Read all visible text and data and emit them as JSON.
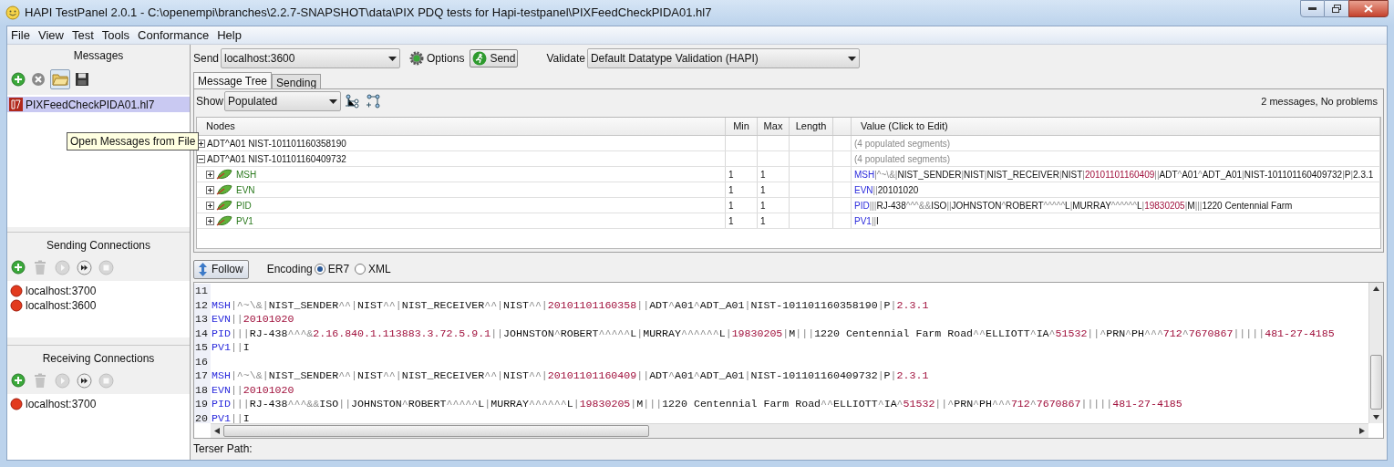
{
  "window": {
    "title": "HAPI TestPanel 2.0.1 - C:\\openempi\\branches\\2.2.7-SNAPSHOT\\data\\PIX PDQ tests for Hapi-testpanel\\PIXFeedCheckPIDA01.hl7"
  },
  "menu": [
    "File",
    "View",
    "Test",
    "Tools",
    "Conformance",
    "Help"
  ],
  "messages_panel": {
    "title": "Messages",
    "files": [
      {
        "name": "PIXFeedCheckPIDA01.hl7",
        "selected": true
      }
    ],
    "tooltip": "Open Messages from File"
  },
  "sending_connections": {
    "title": "Sending Connections",
    "items": [
      "localhost:3700",
      "localhost:3600"
    ]
  },
  "receiving_connections": {
    "title": "Receiving Connections",
    "items": [
      "localhost:3700"
    ]
  },
  "toolbar": {
    "send_label": "Send",
    "send_target": "localhost:3600",
    "options_button": "Options",
    "send_button": "Send",
    "validate_label": "Validate",
    "validator": "Default Datatype Validation (HAPI)"
  },
  "tabs": [
    {
      "label": "Message Tree",
      "selected": true
    },
    {
      "label": "Sending",
      "selected": false
    }
  ],
  "tree": {
    "show_label": "Show",
    "show_value": "Populated",
    "status": "2 messages, No problems",
    "columns": [
      "Nodes",
      "Min",
      "Max",
      "Length",
      "Value (Click to Edit)"
    ],
    "rows": [
      {
        "node": "ADT^A01 NIST-101101160358190",
        "expanded": false,
        "value": [
          {
            "kind": "note",
            "text": "(4 populated segments)"
          }
        ]
      },
      {
        "node": "ADT^A01 NIST-101101160409732",
        "expanded": true,
        "value": [
          {
            "kind": "note",
            "text": "(4 populated segments)"
          }
        ],
        "children": [
          {
            "node": "MSH",
            "expanded": false,
            "min": "1",
            "max": "1",
            "value": [
              {
                "kind": "segment",
                "text": "MSH"
              },
              {
                "kind": "separator",
                "text": "|^~\\&|"
              },
              {
                "kind": "text",
                "text": "NIST_SENDER"
              },
              {
                "kind": "separator",
                "text": "|"
              },
              {
                "kind": "text",
                "text": "NIST"
              },
              {
                "kind": "separator",
                "text": "|"
              },
              {
                "kind": "text",
                "text": "NIST_RECEIVER"
              },
              {
                "kind": "separator",
                "text": "|"
              },
              {
                "kind": "text",
                "text": "NIST"
              },
              {
                "kind": "separator",
                "text": "|"
              },
              {
                "kind": "value",
                "text": "20101101160409"
              },
              {
                "kind": "separator",
                "text": "||"
              },
              {
                "kind": "text",
                "text": "ADT"
              },
              {
                "kind": "separator",
                "text": "^"
              },
              {
                "kind": "text",
                "text": "A01"
              },
              {
                "kind": "separator",
                "text": "^"
              },
              {
                "kind": "text",
                "text": "ADT_A01"
              },
              {
                "kind": "separator",
                "text": "|"
              },
              {
                "kind": "text",
                "text": "NIST-101101160409732"
              },
              {
                "kind": "separator",
                "text": "|"
              },
              {
                "kind": "text",
                "text": "P"
              },
              {
                "kind": "separator",
                "text": "|"
              },
              {
                "kind": "text",
                "text": "2.3.1"
              }
            ]
          },
          {
            "node": "EVN",
            "expanded": false,
            "min": "1",
            "max": "1",
            "value": [
              {
                "kind": "segment",
                "text": "EVN"
              },
              {
                "kind": "separator",
                "text": "||"
              },
              {
                "kind": "text",
                "text": "20101020"
              }
            ]
          },
          {
            "node": "PID",
            "expanded": false,
            "min": "1",
            "max": "1",
            "value": [
              {
                "kind": "segment",
                "text": "PID"
              },
              {
                "kind": "separator",
                "text": "|||"
              },
              {
                "kind": "text",
                "text": "RJ-438"
              },
              {
                "kind": "separator",
                "text": "^^^&&"
              },
              {
                "kind": "text",
                "text": "ISO"
              },
              {
                "kind": "separator",
                "text": "||"
              },
              {
                "kind": "text",
                "text": "JOHNSTON"
              },
              {
                "kind": "separator",
                "text": "^"
              },
              {
                "kind": "text",
                "text": "ROBERT"
              },
              {
                "kind": "separator",
                "text": "^^^^^"
              },
              {
                "kind": "text",
                "text": "L"
              },
              {
                "kind": "separator",
                "text": "|"
              },
              {
                "kind": "text",
                "text": "MURRAY"
              },
              {
                "kind": "separator",
                "text": "^^^^^^"
              },
              {
                "kind": "text",
                "text": "L"
              },
              {
                "kind": "separator",
                "text": "|"
              },
              {
                "kind": "value",
                "text": "19830205"
              },
              {
                "kind": "separator",
                "text": "|"
              },
              {
                "kind": "text",
                "text": "M"
              },
              {
                "kind": "separator",
                "text": "|||"
              },
              {
                "kind": "text",
                "text": "1220 Centennial Farm"
              }
            ]
          },
          {
            "node": "PV1",
            "expanded": false,
            "min": "1",
            "max": "1",
            "value": [
              {
                "kind": "segment",
                "text": "PV1"
              },
              {
                "kind": "separator",
                "text": "||"
              },
              {
                "kind": "text",
                "text": "I"
              }
            ]
          }
        ]
      }
    ]
  },
  "editor": {
    "follow_button": "Follow",
    "encoding_label": "Encoding",
    "encodings": [
      {
        "label": "ER7",
        "selected": true
      },
      {
        "label": "XML",
        "selected": false
      }
    ],
    "lines": [
      {
        "number": "11"
      },
      {
        "number": "12",
        "tokens": [
          {
            "kind": "segment",
            "text": "MSH"
          },
          {
            "kind": "separator",
            "text": "|^~\\&|"
          },
          {
            "kind": "text",
            "text": "NIST_SENDER"
          },
          {
            "kind": "separator",
            "text": "^^|"
          },
          {
            "kind": "text",
            "text": "NIST"
          },
          {
            "kind": "separator",
            "text": "^^|"
          },
          {
            "kind": "text",
            "text": "NIST_RECEIVER"
          },
          {
            "kind": "separator",
            "text": "^^|"
          },
          {
            "kind": "text",
            "text": "NIST"
          },
          {
            "kind": "separator",
            "text": "^^|"
          },
          {
            "kind": "value",
            "text": "20101101160358"
          },
          {
            "kind": "separator",
            "text": "||"
          },
          {
            "kind": "text",
            "text": "ADT"
          },
          {
            "kind": "separator",
            "text": "^"
          },
          {
            "kind": "text",
            "text": "A01"
          },
          {
            "kind": "separator",
            "text": "^"
          },
          {
            "kind": "text",
            "text": "ADT_A01"
          },
          {
            "kind": "separator",
            "text": "|"
          },
          {
            "kind": "text",
            "text": "NIST-101101160358190"
          },
          {
            "kind": "separator",
            "text": "|"
          },
          {
            "kind": "text",
            "text": "P"
          },
          {
            "kind": "separator",
            "text": "|"
          },
          {
            "kind": "value",
            "text": "2.3.1"
          }
        ]
      },
      {
        "number": "13",
        "tokens": [
          {
            "kind": "segment",
            "text": "EVN"
          },
          {
            "kind": "separator",
            "text": "||"
          },
          {
            "kind": "value",
            "text": "20101020"
          }
        ]
      },
      {
        "number": "14",
        "tokens": [
          {
            "kind": "segment",
            "text": "PID"
          },
          {
            "kind": "separator",
            "text": "|||"
          },
          {
            "kind": "text",
            "text": "RJ-438"
          },
          {
            "kind": "separator",
            "text": "^^^&"
          },
          {
            "kind": "value",
            "text": "2.16.840.1.113883.3.72.5.9.1"
          },
          {
            "kind": "separator",
            "text": "||"
          },
          {
            "kind": "text",
            "text": "JOHNSTON"
          },
          {
            "kind": "separator",
            "text": "^"
          },
          {
            "kind": "text",
            "text": "ROBERT"
          },
          {
            "kind": "separator",
            "text": "^^^^^"
          },
          {
            "kind": "text",
            "text": "L"
          },
          {
            "kind": "separator",
            "text": "|"
          },
          {
            "kind": "text",
            "text": "MURRAY"
          },
          {
            "kind": "separator",
            "text": "^^^^^^"
          },
          {
            "kind": "text",
            "text": "L"
          },
          {
            "kind": "separator",
            "text": "|"
          },
          {
            "kind": "value",
            "text": "19830205"
          },
          {
            "kind": "separator",
            "text": "|"
          },
          {
            "kind": "text",
            "text": "M"
          },
          {
            "kind": "separator",
            "text": "|||"
          },
          {
            "kind": "text",
            "text": "1220 Centennial Farm Road"
          },
          {
            "kind": "separator",
            "text": "^^"
          },
          {
            "kind": "text",
            "text": "ELLIOTT"
          },
          {
            "kind": "separator",
            "text": "^"
          },
          {
            "kind": "text",
            "text": "IA"
          },
          {
            "kind": "separator",
            "text": "^"
          },
          {
            "kind": "value",
            "text": "51532"
          },
          {
            "kind": "separator",
            "text": "||^"
          },
          {
            "kind": "text",
            "text": "PRN"
          },
          {
            "kind": "separator",
            "text": "^"
          },
          {
            "kind": "text",
            "text": "PH"
          },
          {
            "kind": "separator",
            "text": "^^^"
          },
          {
            "kind": "value",
            "text": "712"
          },
          {
            "kind": "separator",
            "text": "^"
          },
          {
            "kind": "value",
            "text": "7670867"
          },
          {
            "kind": "separator",
            "text": "|||||"
          },
          {
            "kind": "value",
            "text": "481-27-4185"
          }
        ]
      },
      {
        "number": "15",
        "tokens": [
          {
            "kind": "segment",
            "text": "PV1"
          },
          {
            "kind": "separator",
            "text": "||"
          },
          {
            "kind": "text",
            "text": "I"
          }
        ]
      },
      {
        "number": "16"
      },
      {
        "number": "17",
        "tokens": [
          {
            "kind": "segment",
            "text": "MSH"
          },
          {
            "kind": "separator",
            "text": "|^~\\&|"
          },
          {
            "kind": "text",
            "text": "NIST_SENDER"
          },
          {
            "kind": "separator",
            "text": "^^|"
          },
          {
            "kind": "text",
            "text": "NIST"
          },
          {
            "kind": "separator",
            "text": "^^|"
          },
          {
            "kind": "text",
            "text": "NIST_RECEIVER"
          },
          {
            "kind": "separator",
            "text": "^^|"
          },
          {
            "kind": "text",
            "text": "NIST"
          },
          {
            "kind": "separator",
            "text": "^^|"
          },
          {
            "kind": "value",
            "text": "20101101160409"
          },
          {
            "kind": "separator",
            "text": "||"
          },
          {
            "kind": "text",
            "text": "ADT"
          },
          {
            "kind": "separator",
            "text": "^"
          },
          {
            "kind": "text",
            "text": "A01"
          },
          {
            "kind": "separator",
            "text": "^"
          },
          {
            "kind": "text",
            "text": "ADT_A01"
          },
          {
            "kind": "separator",
            "text": "|"
          },
          {
            "kind": "text",
            "text": "NIST-101101160409732"
          },
          {
            "kind": "separator",
            "text": "|"
          },
          {
            "kind": "text",
            "text": "P"
          },
          {
            "kind": "separator",
            "text": "|"
          },
          {
            "kind": "value",
            "text": "2.3.1"
          }
        ]
      },
      {
        "number": "18",
        "tokens": [
          {
            "kind": "segment",
            "text": "EVN"
          },
          {
            "kind": "separator",
            "text": "||"
          },
          {
            "kind": "value",
            "text": "20101020"
          }
        ]
      },
      {
        "number": "19",
        "tokens": [
          {
            "kind": "segment",
            "text": "PID"
          },
          {
            "kind": "separator",
            "text": "|||"
          },
          {
            "kind": "text",
            "text": "RJ-438"
          },
          {
            "kind": "separator",
            "text": "^^^&&"
          },
          {
            "kind": "text",
            "text": "ISO"
          },
          {
            "kind": "separator",
            "text": "||"
          },
          {
            "kind": "text",
            "text": "JOHNSTON"
          },
          {
            "kind": "separator",
            "text": "^"
          },
          {
            "kind": "text",
            "text": "ROBERT"
          },
          {
            "kind": "separator",
            "text": "^^^^^"
          },
          {
            "kind": "text",
            "text": "L"
          },
          {
            "kind": "separator",
            "text": "|"
          },
          {
            "kind": "text",
            "text": "MURRAY"
          },
          {
            "kind": "separator",
            "text": "^^^^^^"
          },
          {
            "kind": "text",
            "text": "L"
          },
          {
            "kind": "separator",
            "text": "|"
          },
          {
            "kind": "value",
            "text": "19830205"
          },
          {
            "kind": "separator",
            "text": "|"
          },
          {
            "kind": "text",
            "text": "M"
          },
          {
            "kind": "separator",
            "text": "|||"
          },
          {
            "kind": "text",
            "text": "1220 Centennial Farm Road"
          },
          {
            "kind": "separator",
            "text": "^^"
          },
          {
            "kind": "text",
            "text": "ELLIOTT"
          },
          {
            "kind": "separator",
            "text": "^"
          },
          {
            "kind": "text",
            "text": "IA"
          },
          {
            "kind": "separator",
            "text": "^"
          },
          {
            "kind": "value",
            "text": "51532"
          },
          {
            "kind": "separator",
            "text": "||^"
          },
          {
            "kind": "text",
            "text": "PRN"
          },
          {
            "kind": "separator",
            "text": "^"
          },
          {
            "kind": "text",
            "text": "PH"
          },
          {
            "kind": "separator",
            "text": "^^^"
          },
          {
            "kind": "value",
            "text": "712"
          },
          {
            "kind": "separator",
            "text": "^"
          },
          {
            "kind": "value",
            "text": "7670867"
          },
          {
            "kind": "separator",
            "text": "|||||"
          },
          {
            "kind": "value",
            "text": "481-27-4185"
          }
        ]
      },
      {
        "number": "20",
        "tokens": [
          {
            "kind": "segment",
            "text": "PV1"
          },
          {
            "kind": "separator",
            "text": "||"
          },
          {
            "kind": "text",
            "text": "I"
          }
        ]
      }
    ],
    "terser_label": "Terser Path:"
  }
}
